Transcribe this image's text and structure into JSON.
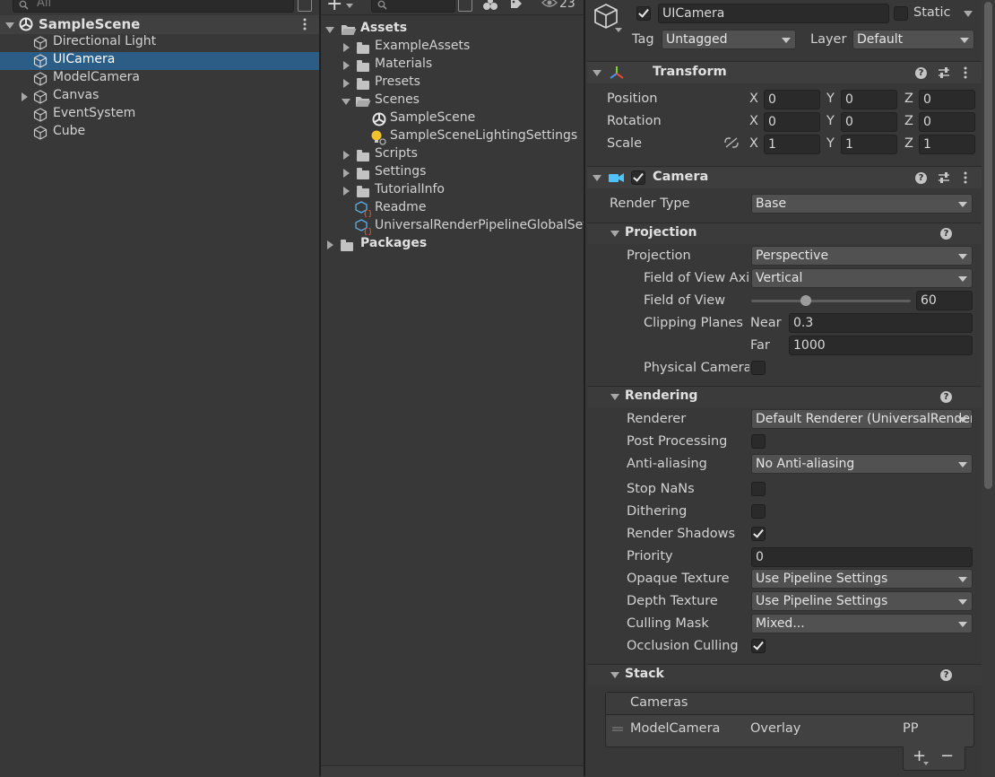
{
  "hierarchy": {
    "search_placeholder": "All",
    "scene_name": "SampleScene",
    "items": [
      {
        "label": "Directional Light",
        "icon": "cube-icon"
      },
      {
        "label": "UICamera",
        "icon": "cube-icon",
        "selected": true
      },
      {
        "label": "ModelCamera",
        "icon": "cube-icon"
      },
      {
        "label": "Canvas",
        "icon": "cube-icon",
        "expandable": true
      },
      {
        "label": "EventSystem",
        "icon": "cube-icon"
      },
      {
        "label": "Cube",
        "icon": "cube-icon"
      }
    ]
  },
  "project": {
    "toolbar": {
      "add_label": "+",
      "visible_count": "23"
    },
    "tree": {
      "assets_label": "Assets",
      "example_assets": "ExampleAssets",
      "materials": "Materials",
      "presets": "Presets",
      "scenes": "Scenes",
      "sample_scene": "SampleScene",
      "lighting_settings": "SampleSceneLightingSettings",
      "scripts": "Scripts",
      "settings": "Settings",
      "tutorial_info": "TutorialInfo",
      "readme": "Readme",
      "urp_global": "UniversalRenderPipelineGlobalSettings",
      "packages": "Packages"
    }
  },
  "inspector": {
    "object_name": "UICamera",
    "static_label": "Static",
    "tag_label": "Tag",
    "tag_value": "Untagged",
    "layer_label": "Layer",
    "layer_value": "Default",
    "transform": {
      "title": "Transform",
      "position_label": "Position",
      "rotation_label": "Rotation",
      "scale_label": "Scale",
      "x": "X",
      "y": "Y",
      "z": "Z",
      "position": [
        "0",
        "0",
        "0"
      ],
      "rotation": [
        "0",
        "0",
        "0"
      ],
      "scale": [
        "1",
        "1",
        "1"
      ]
    },
    "camera": {
      "title": "Camera",
      "render_type_label": "Render Type",
      "render_type_value": "Base",
      "projection_section": "Projection",
      "projection_label": "Projection",
      "projection_value": "Perspective",
      "fov_axis_label": "Field of View Axi",
      "fov_axis_value": "Vertical",
      "fov_label": "Field of View",
      "fov_value": "60",
      "fov_fraction": 0.33,
      "clipping_label": "Clipping Planes",
      "near_label": "Near",
      "near_value": "0.3",
      "far_label": "Far",
      "far_value": "1000",
      "physical_label": "Physical Camera",
      "rendering_section": "Rendering",
      "renderer_label": "Renderer",
      "renderer_value": "Default Renderer (UniversalRenderer)",
      "post_processing_label": "Post Processing",
      "anti_aliasing_label": "Anti-aliasing",
      "anti_aliasing_value": "No Anti-aliasing",
      "stop_nans_label": "Stop NaNs",
      "dithering_label": "Dithering",
      "render_shadows_label": "Render Shadows",
      "priority_label": "Priority",
      "priority_value": "0",
      "opaque_label": "Opaque Texture",
      "opaque_value": "Use Pipeline Settings",
      "depth_label": "Depth Texture",
      "depth_value": "Use Pipeline Settings",
      "culling_label": "Culling Mask",
      "culling_value": "Mixed...",
      "occlusion_label": "Occlusion Culling",
      "stack_section": "Stack",
      "cameras_header": "Cameras",
      "stack_row": {
        "name": "ModelCamera",
        "type": "Overlay",
        "pp": "PP"
      },
      "add_label": "+",
      "remove_label": "−"
    }
  },
  "colors": {
    "selection": "#2c5d87",
    "accent_icon": "#4fc3f7"
  }
}
